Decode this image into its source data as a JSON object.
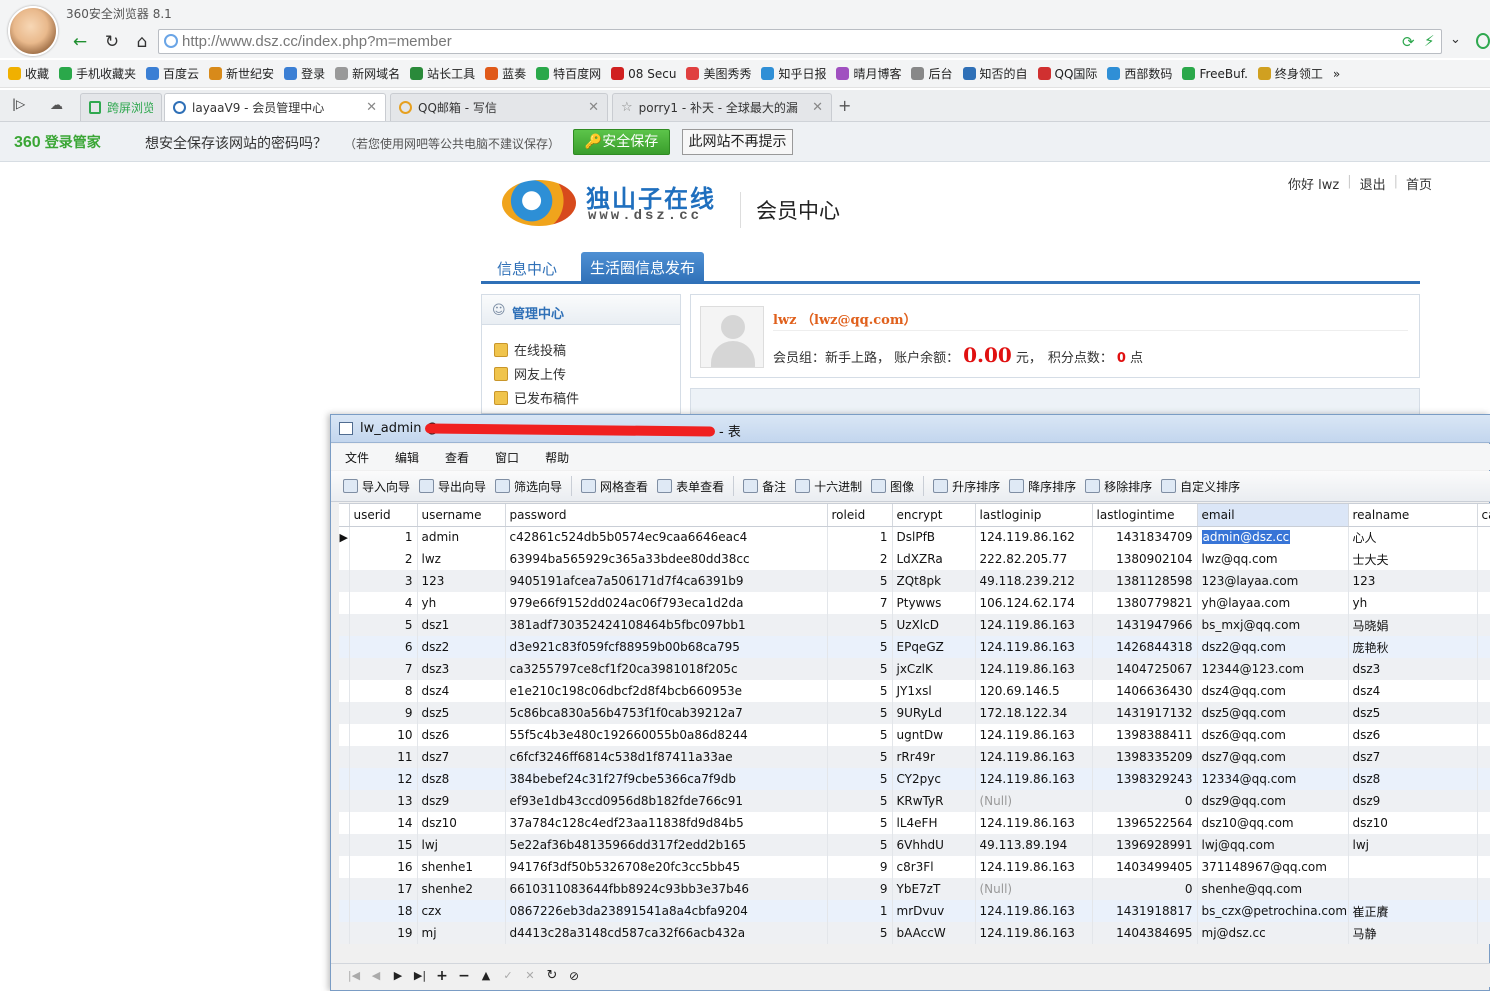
{
  "browser": {
    "app_title": "360安全浏览器 8.1",
    "url": "http://www.dsz.cc/index.php?m=member",
    "bookmarks": [
      "收藏",
      "手机收藏夹",
      "百度云",
      "新世纪安",
      "登录",
      "新网域名",
      "站长工具",
      "蓝奏",
      "特百度网",
      "08 Secu",
      "美图秀秀",
      "知乎日报",
      "晴月博客",
      "后台",
      "知否的自",
      "QQ国际",
      "西部数码",
      "FreeBuf.",
      "终身领工"
    ],
    "tabs": [
      {
        "label": "跨屏浏览"
      },
      {
        "label": "layaaV9 - 会员管理中心"
      },
      {
        "label": "QQ邮箱 - 写信"
      },
      {
        "label": "porry1 - 补天 - 全球最大的漏"
      }
    ],
    "colors": {
      "accent": "#2f70b7",
      "save_green": "#3a9e2c"
    }
  },
  "savebar": {
    "brand": "360",
    "brand_sub": "登录管家",
    "question": "想安全保存该网站的密码吗？",
    "note": "（若您使用网吧等公共电脑不建议保存）",
    "save_button": "安全保存",
    "never_button": "此网站不再提示"
  },
  "site": {
    "logo_cn": "独山子在线",
    "logo_en": "www.dsz.cc",
    "section_title": "会员中心",
    "greeting": "你好 lwz",
    "logout": "退出",
    "home": "首页",
    "nav": [
      "信息中心",
      "生活圈信息发布"
    ],
    "sidebar": {
      "title": "管理中心",
      "items": [
        "在线投稿",
        "网友上传",
        "已发布稿件"
      ]
    },
    "profile": {
      "name": "lwz （lwz@qq.com）",
      "group_label": "会员组：新手上路，  账户余额：",
      "balance": "0.00",
      "balance_unit": "元，",
      "points_label": "积分点数：",
      "points": "0",
      "points_unit": "点"
    }
  },
  "navicat": {
    "title_prefix": "lw_admin @",
    "title_suffix": "- 表",
    "menu": [
      "文件",
      "编辑",
      "查看",
      "窗口",
      "帮助"
    ],
    "toolbar": [
      "导入向导",
      "导出向导",
      "筛选向导",
      "网格查看",
      "表单查看",
      "备注",
      "十六进制",
      "图像",
      "升序排序",
      "降序排序",
      "移除排序",
      "自定义排序"
    ],
    "columns": [
      "userid",
      "username",
      "password",
      "roleid",
      "encrypt",
      "lastloginip",
      "lastlogintime",
      "email",
      "realname",
      "ca"
    ],
    "rows": [
      {
        "userid": "1",
        "username": "admin",
        "password": "c42861c524db5b0574ec9caa6646eac4",
        "roleid": "1",
        "encrypt": "DslPfB",
        "lastloginip": "124.119.86.162",
        "lastlogintime": "1431834709",
        "email": "admin@dsz.cc",
        "realname": "心人"
      },
      {
        "userid": "2",
        "username": "lwz",
        "password": "63994ba565929c365a33bdee80dd38cc",
        "roleid": "2",
        "encrypt": "LdXZRa",
        "lastloginip": "222.82.205.77",
        "lastlogintime": "1380902104",
        "email": "lwz@qq.com",
        "realname": "士大夫"
      },
      {
        "userid": "3",
        "username": "123",
        "password": "9405191afcea7a506171d7f4ca6391b9",
        "roleid": "5",
        "encrypt": "ZQt8pk",
        "lastloginip": "49.118.239.212",
        "lastlogintime": "1381128598",
        "email": "123@layaa.com",
        "realname": "123"
      },
      {
        "userid": "4",
        "username": "yh",
        "password": "979e66f9152dd024ac06f793eca1d2da",
        "roleid": "7",
        "encrypt": "Ptywws",
        "lastloginip": "106.124.62.174",
        "lastlogintime": "1380779821",
        "email": "yh@layaa.com",
        "realname": "yh"
      },
      {
        "userid": "5",
        "username": "dsz1",
        "password": "381adf730352424108464b5fbc097bb1",
        "roleid": "5",
        "encrypt": "UzXlcD",
        "lastloginip": "124.119.86.163",
        "lastlogintime": "1431947966",
        "email": "bs_mxj@qq.com",
        "realname": "马晓娟"
      },
      {
        "userid": "6",
        "username": "dsz2",
        "password": "d3e921c83f059fcf88959b00b68ca795",
        "roleid": "5",
        "encrypt": "EPqeGZ",
        "lastloginip": "124.119.86.163",
        "lastlogintime": "1426844318",
        "email": "dsz2@qq.com",
        "realname": "庞艳秋"
      },
      {
        "userid": "7",
        "username": "dsz3",
        "password": "ca3255797ce8cf1f20ca3981018f205c",
        "roleid": "5",
        "encrypt": "jxCzlK",
        "lastloginip": "124.119.86.163",
        "lastlogintime": "1404725067",
        "email": "12344@123.com",
        "realname": "dsz3"
      },
      {
        "userid": "8",
        "username": "dsz4",
        "password": "e1e210c198c06dbcf2d8f4bcb660953e",
        "roleid": "5",
        "encrypt": "JY1xsl",
        "lastloginip": "120.69.146.5",
        "lastlogintime": "1406636430",
        "email": "dsz4@qq.com",
        "realname": "dsz4"
      },
      {
        "userid": "9",
        "username": "dsz5",
        "password": "5c86bca830a56b4753f1f0cab39212a7",
        "roleid": "5",
        "encrypt": "9URyLd",
        "lastloginip": "172.18.122.34",
        "lastlogintime": "1431917132",
        "email": "dsz5@qq.com",
        "realname": "dsz5"
      },
      {
        "userid": "10",
        "username": "dsz6",
        "password": "55f5c4b3e480c192660055b0a86d8244",
        "roleid": "5",
        "encrypt": "ugntDw",
        "lastloginip": "124.119.86.163",
        "lastlogintime": "1398388411",
        "email": "dsz6@qq.com",
        "realname": "dsz6"
      },
      {
        "userid": "11",
        "username": "dsz7",
        "password": "c6fcf3246ff6814c538d1f87411a33ae",
        "roleid": "5",
        "encrypt": "rRr49r",
        "lastloginip": "124.119.86.163",
        "lastlogintime": "1398335209",
        "email": "dsz7@qq.com",
        "realname": "dsz7"
      },
      {
        "userid": "12",
        "username": "dsz8",
        "password": "384bebef24c31f27f9cbe5366ca7f9db",
        "roleid": "5",
        "encrypt": "CY2pyc",
        "lastloginip": "124.119.86.163",
        "lastlogintime": "1398329243",
        "email": "12334@qq.com",
        "realname": "dsz8"
      },
      {
        "userid": "13",
        "username": "dsz9",
        "password": "ef93e1db43ccd0956d8b182fde766c91",
        "roleid": "5",
        "encrypt": "KRwTyR",
        "lastloginip": "(Null)",
        "lastlogintime": "0",
        "email": "dsz9@qq.com",
        "realname": "dsz9"
      },
      {
        "userid": "14",
        "username": "dsz10",
        "password": "37a784c128c4edf23aa11838fd9d84b5",
        "roleid": "5",
        "encrypt": "lL4eFH",
        "lastloginip": "124.119.86.163",
        "lastlogintime": "1396522564",
        "email": "dsz10@qq.com",
        "realname": "dsz10"
      },
      {
        "userid": "15",
        "username": "lwj",
        "password": "5e22af36b48135966dd317f2edd2b165",
        "roleid": "5",
        "encrypt": "6VhhdU",
        "lastloginip": "49.113.89.194",
        "lastlogintime": "1396928991",
        "email": "lwj@qq.com",
        "realname": "lwj"
      },
      {
        "userid": "16",
        "username": "shenhe1",
        "password": "94176f3df50b5326708e20fc3cc5bb45",
        "roleid": "9",
        "encrypt": "c8r3Fl",
        "lastloginip": "124.119.86.163",
        "lastlogintime": "1403499405",
        "email": "371148967@qq.com",
        "realname": ""
      },
      {
        "userid": "17",
        "username": "shenhe2",
        "password": "6610311083644fbb8924c93bb3e37b46",
        "roleid": "9",
        "encrypt": "YbE7zT",
        "lastloginip": "(Null)",
        "lastlogintime": "0",
        "email": "shenhe@qq.com",
        "realname": ""
      },
      {
        "userid": "18",
        "username": "czx",
        "password": "0867226eb3da23891541a8a4cbfa9204",
        "roleid": "1",
        "encrypt": "mrDvuv",
        "lastloginip": "124.119.86.163",
        "lastlogintime": "1431918817",
        "email": "bs_czx@petrochina.com.c",
        "realname": "崔正賡"
      },
      {
        "userid": "19",
        "username": "mj",
        "password": "d4413c28a3148cd587ca32f66acb432a",
        "roleid": "5",
        "encrypt": "bAAccW",
        "lastloginip": "124.119.86.163",
        "lastlogintime": "1404384695",
        "email": "mj@dsz.cc",
        "realname": "马静"
      }
    ]
  }
}
